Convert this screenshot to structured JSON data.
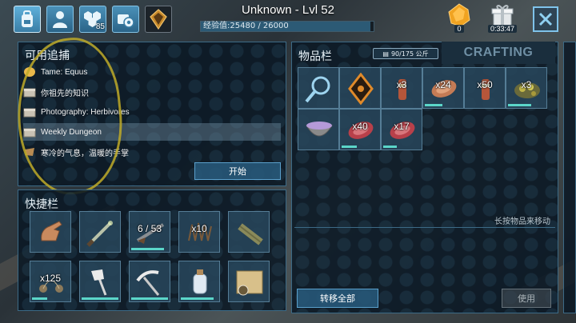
{
  "header": {
    "player_name": "Unknown - Lvl 52",
    "xp_label": "经验值:25480 / 26000",
    "xp_fraction": 0.98,
    "tabs": [
      {
        "icon": "backpack-icon",
        "badge": ""
      },
      {
        "icon": "person-icon",
        "badge": ""
      },
      {
        "icon": "hexagons-icon",
        "badge": "85"
      },
      {
        "icon": "settings-icon",
        "badge": ""
      },
      {
        "icon": "engram-icon",
        "badge": ""
      }
    ],
    "amber_count": "0",
    "gift_timer": "0:33:47"
  },
  "quests": {
    "title": "可用追捕",
    "items": [
      {
        "label": "Tame: Equus",
        "icon": "amber-icon",
        "selected": false
      },
      {
        "label": "你祖先的知识",
        "icon": "chest-icon",
        "selected": false
      },
      {
        "label": "Photography: Herbivores",
        "icon": "chest-icon",
        "selected": false
      },
      {
        "label": "Weekly Dungeon",
        "icon": "chest-icon",
        "selected": true
      },
      {
        "label": "寒冷的气息，温暖的手掌",
        "icon": "hide-icon",
        "selected": false
      }
    ],
    "start_label": "开始"
  },
  "hotbar": {
    "title": "快捷栏",
    "slots": [
      {
        "icon": "hand-icon",
        "qty": "",
        "durability": 0
      },
      {
        "icon": "sword-icon",
        "qty": "",
        "durability": 0
      },
      {
        "icon": "rifle-icon",
        "qty": "6 / 53",
        "durability": 0.85
      },
      {
        "icon": "spike-trap-icon",
        "qty": "x10",
        "durability": 0
      },
      {
        "icon": "spyglass-icon",
        "qty": "",
        "durability": 0
      },
      {
        "icon": "bola-icon",
        "qty": "x125",
        "durability": 0.4
      },
      {
        "icon": "hatchet-icon",
        "qty": "",
        "durability": 0.95
      },
      {
        "icon": "pickaxe-icon",
        "qty": "",
        "durability": 0.95
      },
      {
        "icon": "bottle-icon",
        "qty": "",
        "durability": 0.85
      },
      {
        "icon": "map-icon",
        "qty": "",
        "durability": 0
      }
    ]
  },
  "inventory": {
    "title": "物品栏",
    "weight": "90/175 公斤",
    "crafting_tab": "CRAFTING",
    "slots": [
      {
        "icon": "magnifier-icon",
        "qty": "",
        "durability": 0
      },
      {
        "icon": "implant-icon",
        "qty": "",
        "durability": 0
      },
      {
        "icon": "ammo-icon",
        "qty": "x3",
        "durability": 0
      },
      {
        "icon": "meat-icon",
        "qty": "x24",
        "durability": 0.45
      },
      {
        "icon": "ammo-icon",
        "qty": "x50",
        "durability": 0
      },
      {
        "icon": "berries-icon",
        "qty": "x3",
        "durability": 0.6
      },
      {
        "icon": "bowl-icon",
        "qty": "",
        "durability": 0
      },
      {
        "icon": "meat-icon",
        "qty": "x40",
        "durability": 0.4
      },
      {
        "icon": "meat-icon",
        "qty": "x17",
        "durability": 0.35
      }
    ],
    "hint": "长按物品来移动",
    "transfer_all_label": "转移全部",
    "use_label": "使用"
  }
}
